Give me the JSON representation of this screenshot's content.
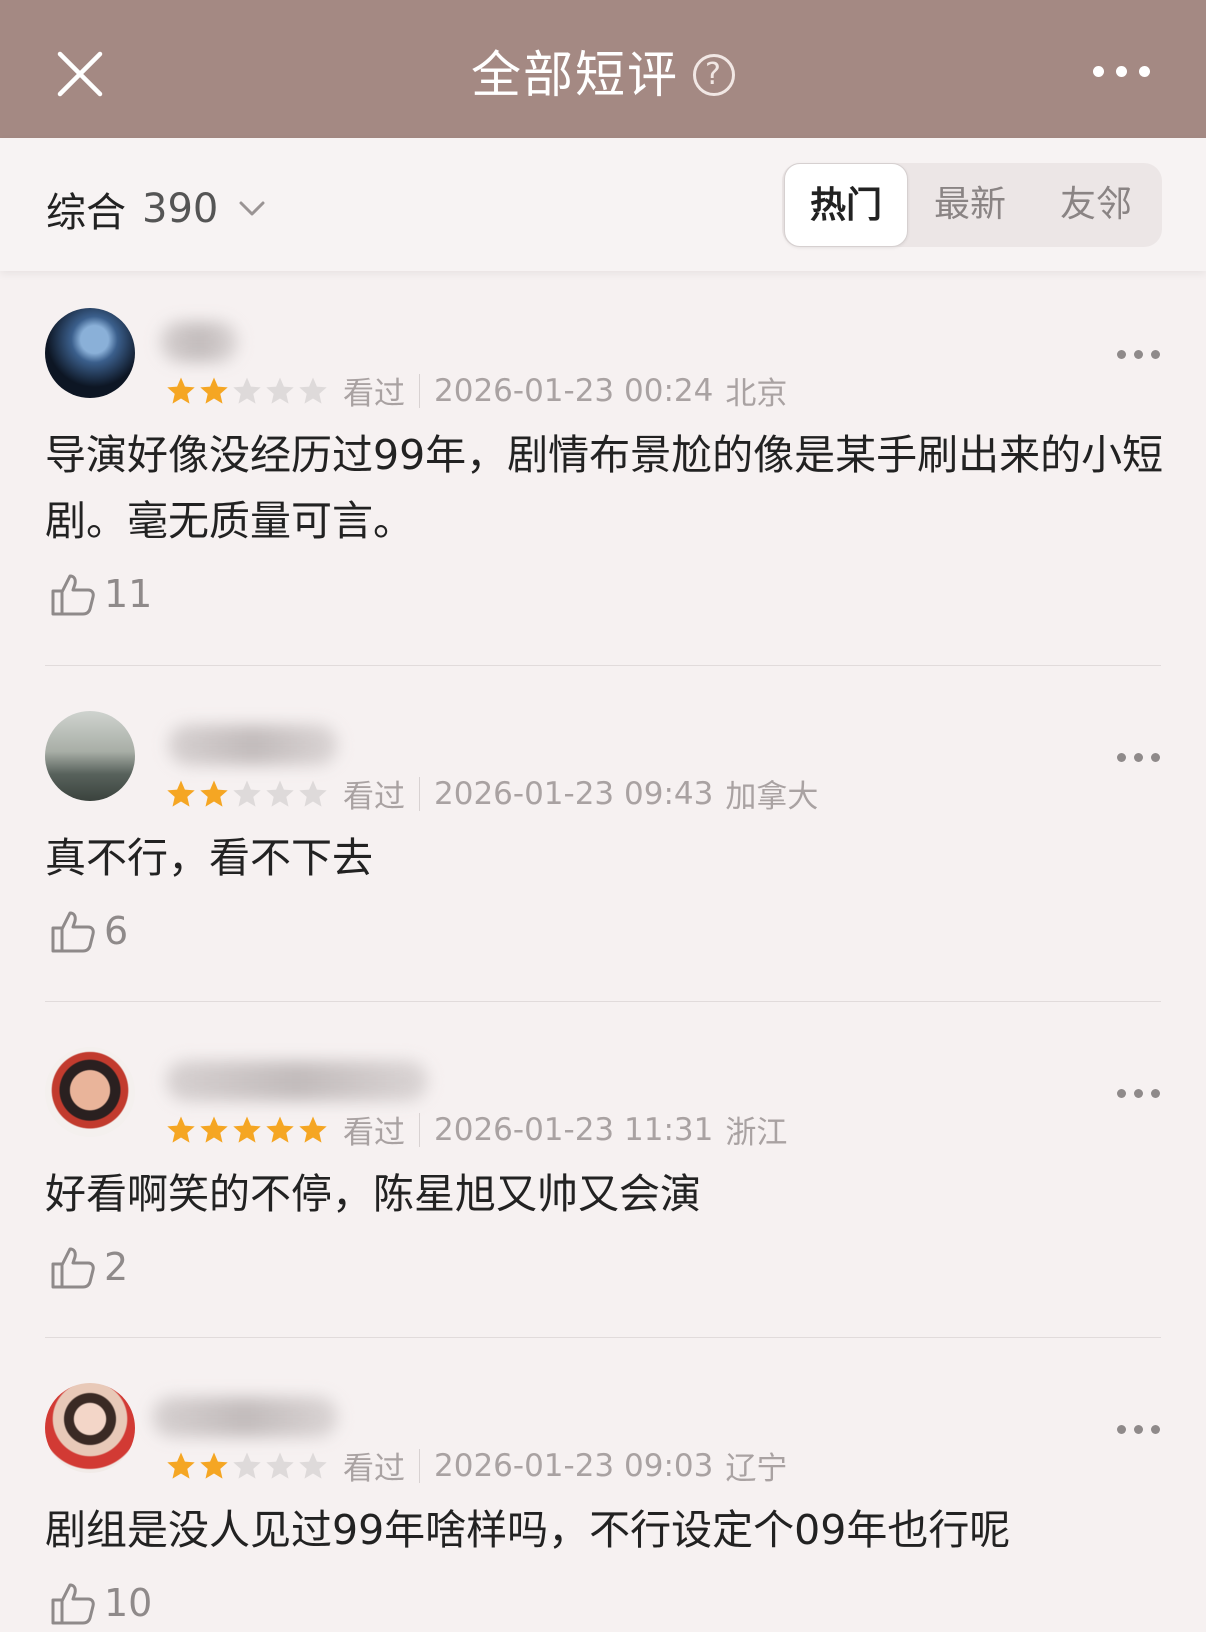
{
  "header": {
    "title": "全部短评",
    "help_symbol": "?"
  },
  "filter": {
    "sort_label": "综合",
    "count": "390",
    "tabs": [
      {
        "label": "热门",
        "active": true
      },
      {
        "label": "最新",
        "active": false
      },
      {
        "label": "友邻",
        "active": false
      }
    ]
  },
  "comments": [
    {
      "rating": 2,
      "status": "看过",
      "datetime": "2026-01-23 00:24",
      "location": "北京",
      "text": "导演好像没经历过99年，剧情布景尬的像是某手刷出来的小短剧。毫无质量可言。",
      "likes": "11"
    },
    {
      "rating": 2,
      "status": "看过",
      "datetime": "2026-01-23 09:43",
      "location": "加拿大",
      "text": "真不行，看不下去",
      "likes": "6"
    },
    {
      "rating": 5,
      "status": "看过",
      "datetime": "2026-01-23 11:31",
      "location": "浙江",
      "text": "好看啊笑的不停，陈星旭又帅又会演",
      "likes": "2"
    },
    {
      "rating": 2,
      "status": "看过",
      "datetime": "2026-01-23 09:03",
      "location": "辽宁",
      "text": "剧组是没人见过99年啥样吗，不行设定个09年也行呢",
      "likes": "10"
    }
  ],
  "colors": {
    "header_bg": "#a48983",
    "star_filled": "#f5a623",
    "star_empty": "#dedada"
  }
}
